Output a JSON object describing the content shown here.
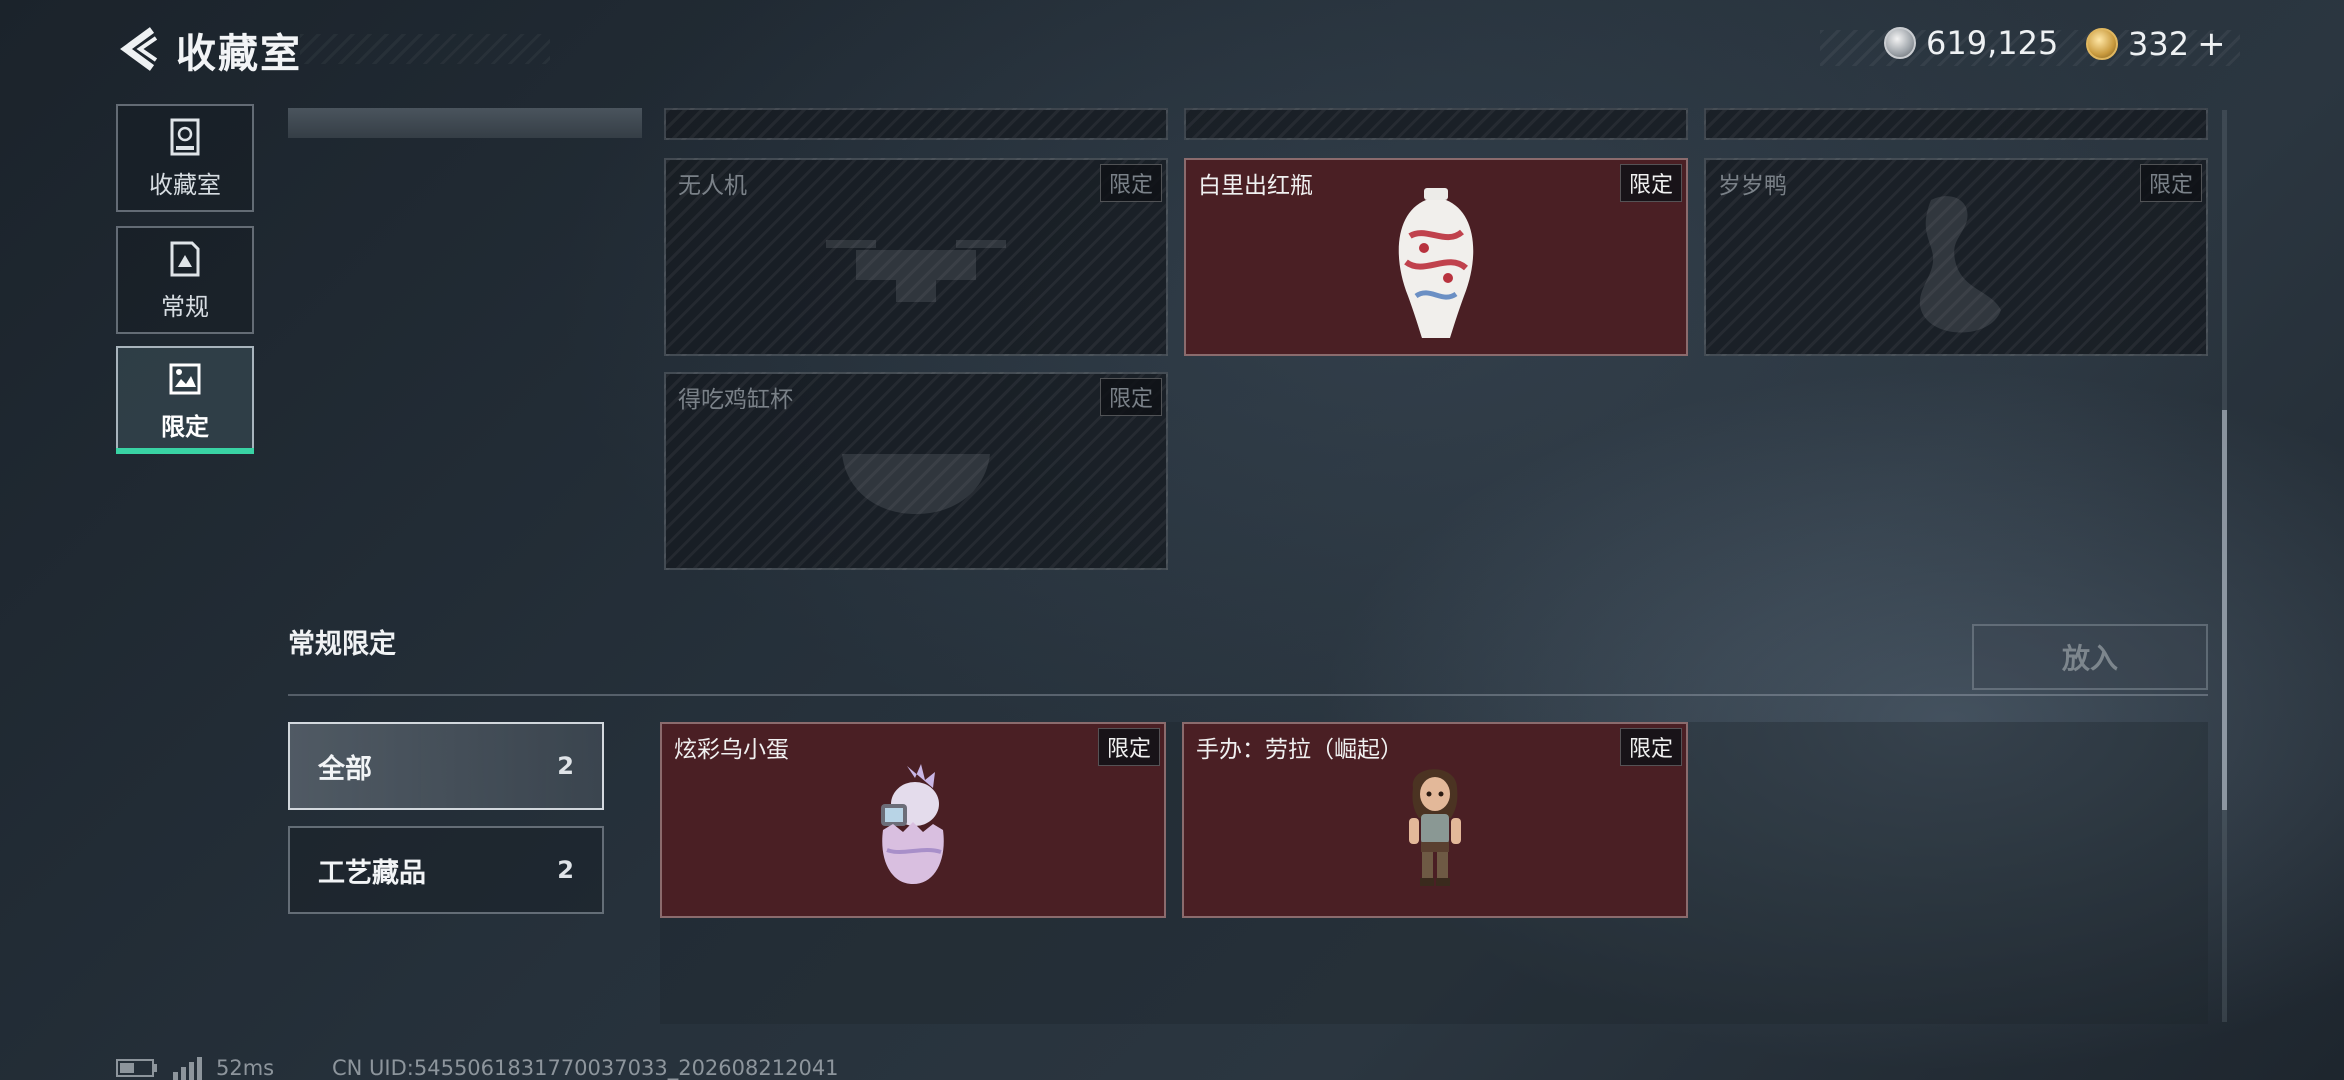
{
  "header": {
    "title": "收藏室",
    "currency_silver": "619,125",
    "currency_gold": "332",
    "plus_label": "+"
  },
  "nav": {
    "items": [
      {
        "label": "收藏室",
        "icon": "trophy-cabinet-icon"
      },
      {
        "label": "常规",
        "icon": "document-triangle-icon"
      },
      {
        "label": "限定",
        "icon": "picture-frame-icon"
      }
    ],
    "active_index": 2
  },
  "upper_grid": {
    "cards": [
      {
        "name": "无人机",
        "badge": "限定",
        "state": "locked",
        "icon": "drone-icon"
      },
      {
        "name": "白里出红瓶",
        "badge": "限定",
        "state": "owned",
        "icon": "porcelain-vase-icon"
      },
      {
        "name": "岁岁鸭",
        "badge": "限定",
        "state": "locked",
        "icon": "duck-icon"
      },
      {
        "name": "得吃鸡缸杯",
        "badge": "限定",
        "state": "locked",
        "icon": "bowl-icon"
      }
    ]
  },
  "section": {
    "title": "常规限定",
    "put_button": "放入"
  },
  "filters": [
    {
      "label": "全部",
      "count": "2"
    },
    {
      "label": "工艺藏品",
      "count": "2"
    }
  ],
  "lower_grid": {
    "cards": [
      {
        "name": "炫彩乌小蛋",
        "badge": "限定",
        "state": "owned",
        "icon": "egg-creature-icon"
      },
      {
        "name": "手办：劳拉（崛起）",
        "badge": "限定",
        "state": "owned",
        "icon": "figurine-icon"
      }
    ]
  },
  "footer": {
    "ping": "52ms",
    "uid": "CN UID:5455061831770037033_202608212041"
  },
  "colors": {
    "accent": "#39d3a4",
    "owned_card": "#4a1f24"
  }
}
